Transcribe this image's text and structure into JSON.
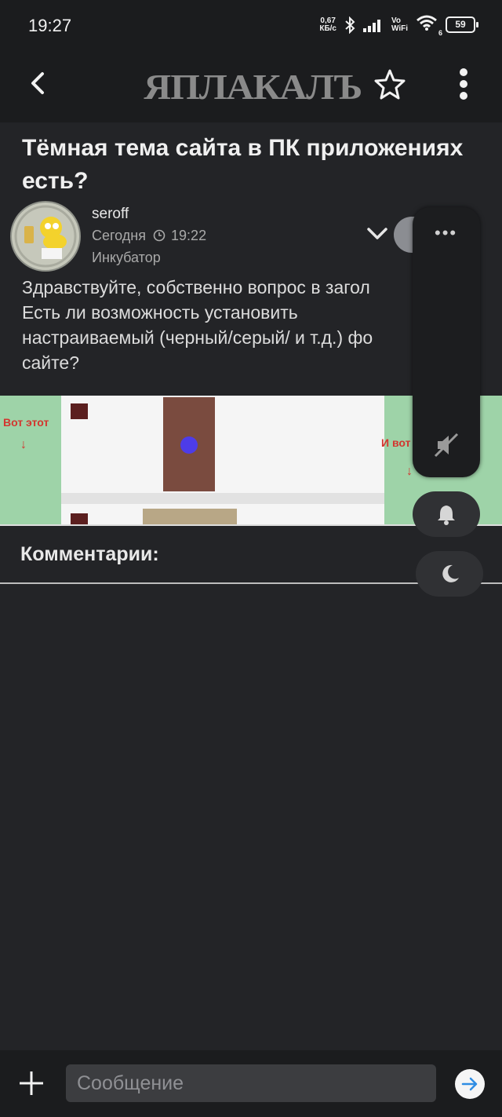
{
  "status_bar": {
    "time": "19:27",
    "net_speed": "0,67",
    "net_unit": "КБ/с",
    "vowifi_top": "Vo",
    "vowifi_bottom": "WiFi",
    "wifi_sub": "6",
    "battery": "59"
  },
  "app_bar": {
    "logo": "ЯПЛАКАЛЪ",
    "back_icon": "back-arrow-icon",
    "star_icon": "star-icon",
    "menu_icon": "more-vert-icon"
  },
  "topic": {
    "title": "Тёмная тема сайта в ПК приложениях есть?"
  },
  "post": {
    "author": "seroff",
    "date": "Сегодня",
    "time": "19:22",
    "rank": "Инкубатор",
    "text_lines": [
      "Здравствуйте, собственно вопрос в загол",
      "Есть ли возможность установить",
      "настраиваемый (черный/серый/ и т.д.) фо",
      "сайте?"
    ],
    "image_labels": {
      "left": "Вот этот",
      "right": "И вот"
    }
  },
  "comments": {
    "heading": "Комментарии:"
  },
  "floating_panel": {
    "more_label": "•••"
  },
  "composer": {
    "placeholder": "Сообщение"
  },
  "colors": {
    "background": "#232427",
    "bar": "#1b1c1e",
    "logo": "#8a8a8a",
    "accent_send": "#2f8de4"
  }
}
